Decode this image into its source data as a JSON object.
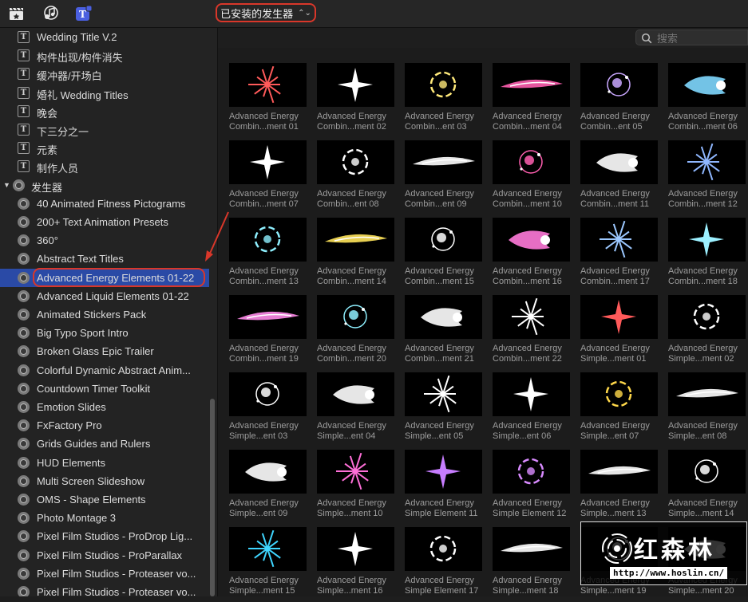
{
  "toolbar": {
    "icons": [
      "clapper-icon",
      "music-photo-icon",
      "titles-icon"
    ],
    "picker_label": "已安装的发生器",
    "accent": "#d9372a"
  },
  "search": {
    "placeholder": "搜索"
  },
  "sidebar": {
    "title_items": [
      "Wedding Title V.2",
      "构件出现/构件消失",
      "缓冲器/开场白",
      "婚礼 Wedding Titles",
      "晚会",
      "下三分之一",
      "元素",
      "制作人员"
    ],
    "generators_header": "发生器",
    "generator_items": [
      "40 Animated Fitness Pictograms",
      "200+ Text Animation Presets",
      "360°",
      "Abstract Text Titles",
      "Advanced Energy Elements 01-22",
      "Advanced Liquid Elements 01-22",
      "Animated Stickers Pack",
      "Big Typo Sport Intro",
      "Broken Glass Epic Trailer",
      "Colorful Dynamic Abstract Anim...",
      "Countdown Timer Toolkit",
      "Emotion Slides",
      "FxFactory Pro",
      "Grids Guides and Rulers",
      "HUD Elements",
      "Multi Screen Slideshow",
      "OMS - Shape Elements",
      "Photo Montage 3",
      "Pixel Film Studios - ProDrop Lig...",
      "Pixel Film Studios - ProParallax",
      "Pixel Film Studios - Proteaser vo...",
      "Pixel Film Studios - Proteaser vo..."
    ],
    "selected_index": 4,
    "selected_color": "#2a4aa6"
  },
  "grid": {
    "items": [
      [
        "Advanced Energy",
        "Combin...ment 01"
      ],
      [
        "Advanced Energy",
        "Combin...ment 02"
      ],
      [
        "Advanced Energy",
        "Combin...ent 03"
      ],
      [
        "Advanced Energy",
        "Combin...ment 04"
      ],
      [
        "Advanced Energy",
        "Combin...ent 05"
      ],
      [
        "Advanced Energy",
        "Combin...ment 06"
      ],
      [
        "Advanced Energy",
        "Combin...ment 07"
      ],
      [
        "Advanced Energy",
        "Combin...ent 08"
      ],
      [
        "Advanced Energy",
        "Combin...ent 09"
      ],
      [
        "Advanced Energy",
        "Combin...ment 10"
      ],
      [
        "Advanced Energy",
        "Combin...ment 11"
      ],
      [
        "Advanced Energy",
        "Combin...ment 12"
      ],
      [
        "Advanced Energy",
        "Combin...ment 13"
      ],
      [
        "Advanced Energy",
        "Combin...ment 14"
      ],
      [
        "Advanced Energy",
        "Combin...ment 15"
      ],
      [
        "Advanced Energy",
        "Combin...ment 16"
      ],
      [
        "Advanced Energy",
        "Combin...ment 17"
      ],
      [
        "Advanced Energy",
        "Combin...ment 18"
      ],
      [
        "Advanced Energy",
        "Combin...ment 19"
      ],
      [
        "Advanced Energy",
        "Combin...ment 20"
      ],
      [
        "Advanced Energy",
        "Combin...ment 21"
      ],
      [
        "Advanced Energy",
        "Combin...ment 22"
      ],
      [
        "Advanced Energy",
        "Simple...ment 01"
      ],
      [
        "Advanced Energy",
        "Simple...ment 02"
      ],
      [
        "Advanced Energy",
        "Simple...ent 03"
      ],
      [
        "Advanced Energy",
        "Simple...ent 04"
      ],
      [
        "Advanced Energy",
        "Simple...ent 05"
      ],
      [
        "Advanced Energy",
        "Simple...ent 06"
      ],
      [
        "Advanced Energy",
        "Simple...ent 07"
      ],
      [
        "Advanced Energy",
        "Simple...ent 08"
      ],
      [
        "Advanced Energy",
        "Simple...ent 09"
      ],
      [
        "Advanced Energy",
        "Simple...ment 10"
      ],
      [
        "Advanced Energy",
        "Simple Element 11"
      ],
      [
        "Advanced Energy",
        "Simple Element 12"
      ],
      [
        "Advanced Energy",
        "Simple...ment 13"
      ],
      [
        "Advanced Energy",
        "Simple...ment 14"
      ],
      [
        "Advanced Energy",
        "Simple...ment 15"
      ],
      [
        "Advanced Energy",
        "Simple...ment 16"
      ],
      [
        "Advanced Energy",
        "Simple Element 17"
      ],
      [
        "Advanced Energy",
        "Simple...ment 18"
      ],
      [
        "Advanced Energy",
        "Simple...ment 19"
      ],
      [
        "Advanced Energy",
        "Simple...ment 20"
      ]
    ],
    "thumb_colors": [
      "#ff5a5a",
      "#ffffff",
      "#ffe97a",
      "#ff5fb0",
      "#c9a7ff",
      "#7fd8ff",
      "#ffffff",
      "#ffffff",
      "#ffffff",
      "#ff5fb0",
      "#ffffff",
      "#8fb7ff",
      "#8ff0ff",
      "#ffe45a",
      "#ffffff",
      "#ff7ad9",
      "#9cc8ff",
      "#9cf0ff",
      "#ff8bea",
      "#8ff0ff",
      "#ffffff",
      "#ffffff",
      "#ff5a5a",
      "#ffffff",
      "#ffffff",
      "#ffffff",
      "#ffffff",
      "#ffffff",
      "#ffd84a",
      "#ffffff",
      "#ffffff",
      "#ff6fd8",
      "#c77dff",
      "#d98bff",
      "#ffffff",
      "#ffffff",
      "#3fd6ff",
      "#ffffff",
      "#ffffff",
      "#ffffff",
      "#ffffff",
      "#ffffff"
    ]
  },
  "watermark": {
    "text": "红森林",
    "url": "http://www.hoslin.cn/"
  }
}
